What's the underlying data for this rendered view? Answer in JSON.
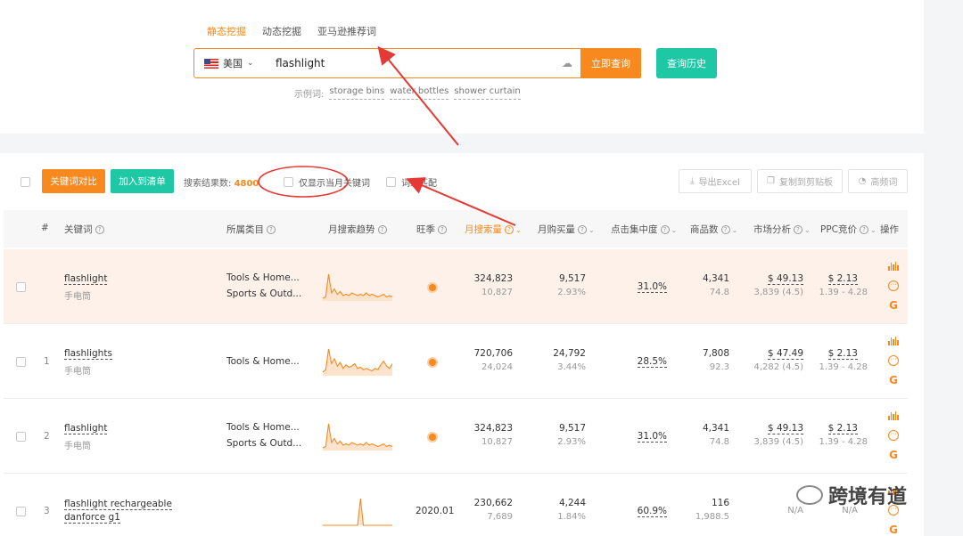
{
  "search_tabs": [
    "静态挖掘",
    "动态挖掘",
    "亚马逊推荐词"
  ],
  "search": {
    "country": "美国",
    "query": "flashlight",
    "submit_label": "立即查询",
    "history_label": "查询历史",
    "examples_label": "示例词:",
    "examples": [
      "storage bins",
      "water bottles",
      "shower curtain"
    ]
  },
  "toolbar": {
    "compare_label": "关键词对比",
    "add_label": "加入到清单",
    "result_label": "搜索结果数:",
    "result_count": "4800",
    "option_current_month": "仅显示当月关键词",
    "option_phrase_match": "词组匹配",
    "export_label": "导出Excel",
    "copy_label": "复制到剪贴板",
    "freq_label": "高频词"
  },
  "table": {
    "headers": {
      "index": "#",
      "keyword": "关键词",
      "category": "所属类目",
      "trend": "月搜索趋势",
      "season": "旺季",
      "search_volume": "月搜索量",
      "purchases": "月购买量",
      "click_concentration": "点击集中度",
      "products": "商品数",
      "market": "市场分析",
      "ppc": "PPC竞价",
      "actions": "操作"
    },
    "rows": [
      {
        "index": "",
        "keyword": "flashlight",
        "keyword_cn": "手电筒",
        "cat1": "Tools & Home...",
        "cat2": "Sports & Outd...",
        "season": "",
        "search": "324,823",
        "search_sub": "10,827",
        "purchase": "9,517",
        "purchase_sub": "2.93%",
        "click": "31.0%",
        "products": "4,341",
        "products_sub": "74.8",
        "market": "$ 49.13",
        "market_sub": "3,839 (4.5)",
        "ppc": "$ 2.13",
        "ppc_sub": "1.39 - 4.28",
        "trend": [
          2,
          3,
          20,
          6,
          9,
          5,
          7,
          4,
          5,
          4,
          6,
          5,
          4,
          5,
          4,
          6,
          4,
          5,
          4,
          3,
          4,
          5,
          3,
          4,
          3
        ],
        "hot": true
      },
      {
        "index": "1",
        "keyword": "flashlights",
        "keyword_cn": "手电筒",
        "cat1": "Tools & Home...",
        "cat2": "",
        "season": "",
        "search": "720,706",
        "search_sub": "24,024",
        "purchase": "24,792",
        "purchase_sub": "3.44%",
        "click": "28.5%",
        "products": "7,808",
        "products_sub": "92.3",
        "market": "$ 47.49",
        "market_sub": "4,282 (4.5)",
        "ppc": "$ 2.13",
        "ppc_sub": "1.39 - 4.28",
        "trend": [
          3,
          5,
          22,
          10,
          14,
          8,
          11,
          6,
          9,
          7,
          8,
          10,
          6,
          7,
          5,
          6,
          5,
          4,
          6,
          5,
          9,
          12,
          8,
          6,
          10
        ],
        "hot": true
      },
      {
        "index": "2",
        "keyword": "flashlight",
        "keyword_cn": "手电筒",
        "cat1": "Tools & Home...",
        "cat2": "Sports & Outd...",
        "season": "",
        "search": "324,823",
        "search_sub": "10,827",
        "purchase": "9,517",
        "purchase_sub": "2.93%",
        "click": "31.0%",
        "products": "4,341",
        "products_sub": "74.8",
        "market": "$ 49.13",
        "market_sub": "3,839 (4.5)",
        "ppc": "$ 2.13",
        "ppc_sub": "1.39 - 4.28",
        "trend": [
          2,
          3,
          20,
          6,
          9,
          5,
          7,
          4,
          5,
          4,
          6,
          5,
          4,
          5,
          4,
          6,
          4,
          5,
          4,
          3,
          4,
          5,
          3,
          4,
          3
        ],
        "hot": true
      },
      {
        "index": "3",
        "keyword": "flashlight rechargeable danforce g1",
        "keyword_cn": "",
        "cat1": "",
        "cat2": "",
        "season": "2020.01",
        "search": "230,662",
        "search_sub": "7,689",
        "purchase": "4,244",
        "purchase_sub": "1.84%",
        "click": "60.9%",
        "products": "116",
        "products_sub": "1,988.5",
        "market": "N/A",
        "market_sub": "",
        "ppc": "N/A",
        "ppc_sub": "",
        "trend": [
          0,
          0,
          0,
          0,
          0,
          0,
          0,
          0,
          0,
          0,
          0,
          0,
          0,
          30,
          0,
          0,
          0,
          0,
          0,
          0,
          0,
          0,
          0,
          0,
          0
        ],
        "hot": false
      }
    ]
  },
  "watermark": "跨境有道",
  "colors": {
    "accent": "#f7891e",
    "teal": "#1ec8a5",
    "annotation": "#e53935"
  }
}
